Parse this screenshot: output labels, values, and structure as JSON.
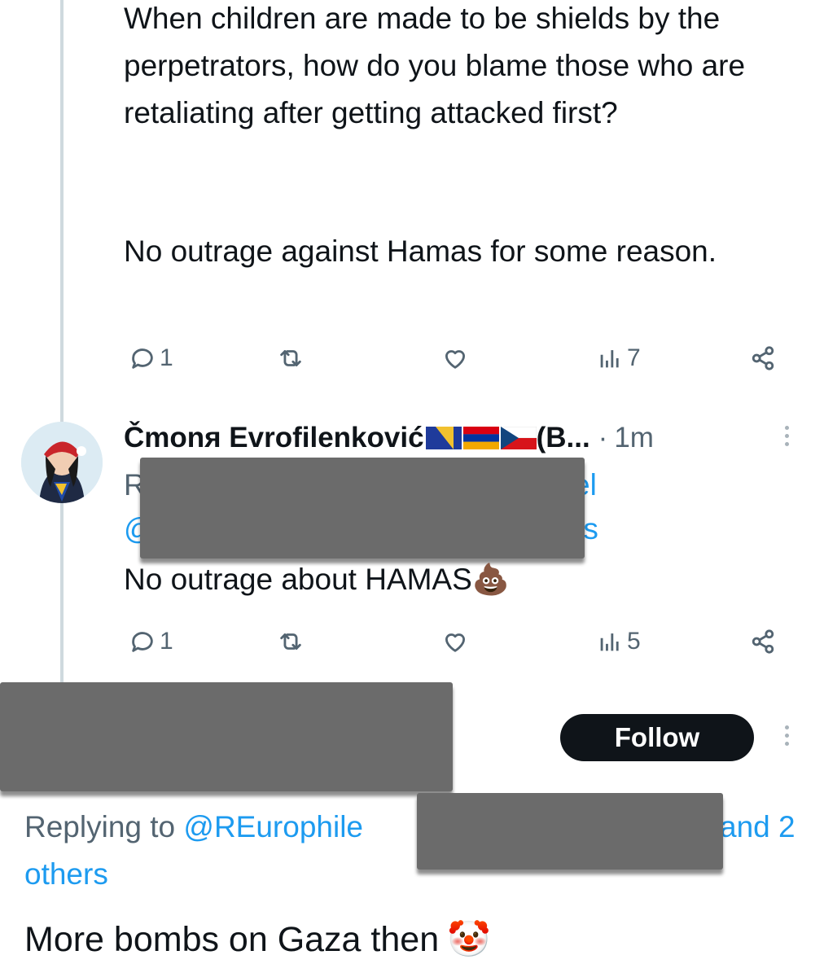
{
  "tweet1": {
    "paragraph1": "When children are made to be shields by the perpetrators, how do you blame those who are retaliating after getting attacked first?",
    "paragraph2": "No outrage against Hamas for some reason.",
    "actions": {
      "replies": "1",
      "reposts": "",
      "likes": "",
      "views": "7"
    }
  },
  "tweet2": {
    "display_name": "Čmonя Evrofilenković",
    "display_name_suffix": "(B...",
    "separator": "·",
    "timestamp": "1m",
    "replying_fragment_line1_start": "R",
    "replying_fragment_line1_end": "el",
    "replying_fragment_line2_start": "@",
    "replying_fragment_line2_end": "rs",
    "text": "No outrage about HAMAS",
    "emoji": "💩",
    "actions": {
      "replies": "1",
      "reposts": "",
      "likes": "",
      "views": "5"
    }
  },
  "tweet3": {
    "follow_label": "Follow",
    "replying_prefix": "Replying to ",
    "replying_handle": "@REurophile",
    "replying_suffix": "and 2",
    "replying_suffix_line2": "others",
    "text": "More bombs on Gaza then",
    "emoji": "🤡"
  },
  "icons": {
    "reply": "reply-icon",
    "repost": "repost-icon",
    "like": "heart-icon",
    "views": "views-icon",
    "share": "share-icon",
    "more": "more-vertical-icon"
  },
  "colors": {
    "text": "#0f1419",
    "secondary": "#536471",
    "link": "#1d9bf0",
    "follow_bg": "#0f1419",
    "thread_line": "#cfd9de",
    "redaction": "#6b6b6b"
  }
}
